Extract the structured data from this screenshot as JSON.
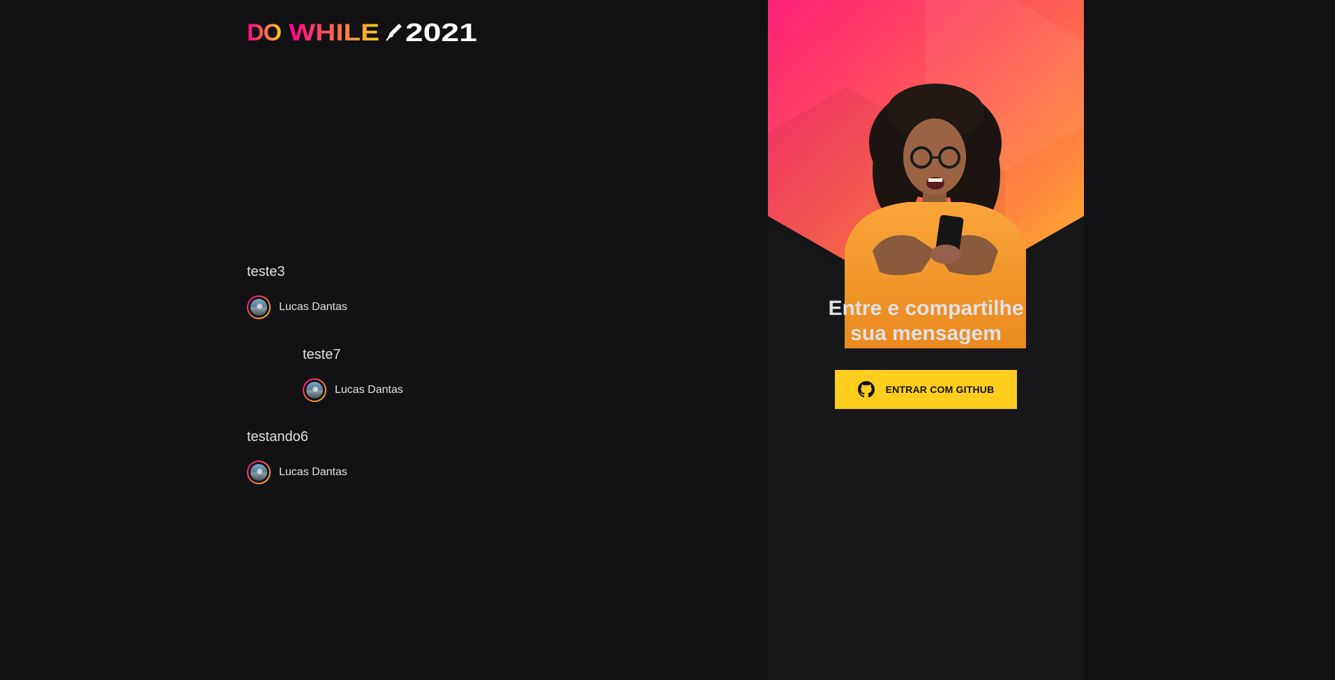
{
  "header": {
    "logo_text_do": "DO",
    "logo_text_while": "WHILE",
    "logo_text_year": "2021"
  },
  "messages": [
    {
      "content": "teste3",
      "user": {
        "name": "Lucas Dantas"
      }
    },
    {
      "content": "teste7",
      "user": {
        "name": "Lucas Dantas"
      }
    },
    {
      "content": "testando6",
      "user": {
        "name": "Lucas Dantas"
      }
    }
  ],
  "login": {
    "title_line1": "Entre e compartilhe",
    "title_line2": "sua mensagem",
    "button_label": "ENTRAR COM GITHUB"
  },
  "colors": {
    "background": "#121214",
    "panel": "#17171a",
    "accent_yellow": "#ffcd1e",
    "accent_pink": "#ff008e",
    "text": "#e1e1e6"
  },
  "icons": {
    "logo": "dowhile-logo",
    "rocket": "rocket-icon",
    "github": "github-icon",
    "avatar": "user-avatar"
  }
}
